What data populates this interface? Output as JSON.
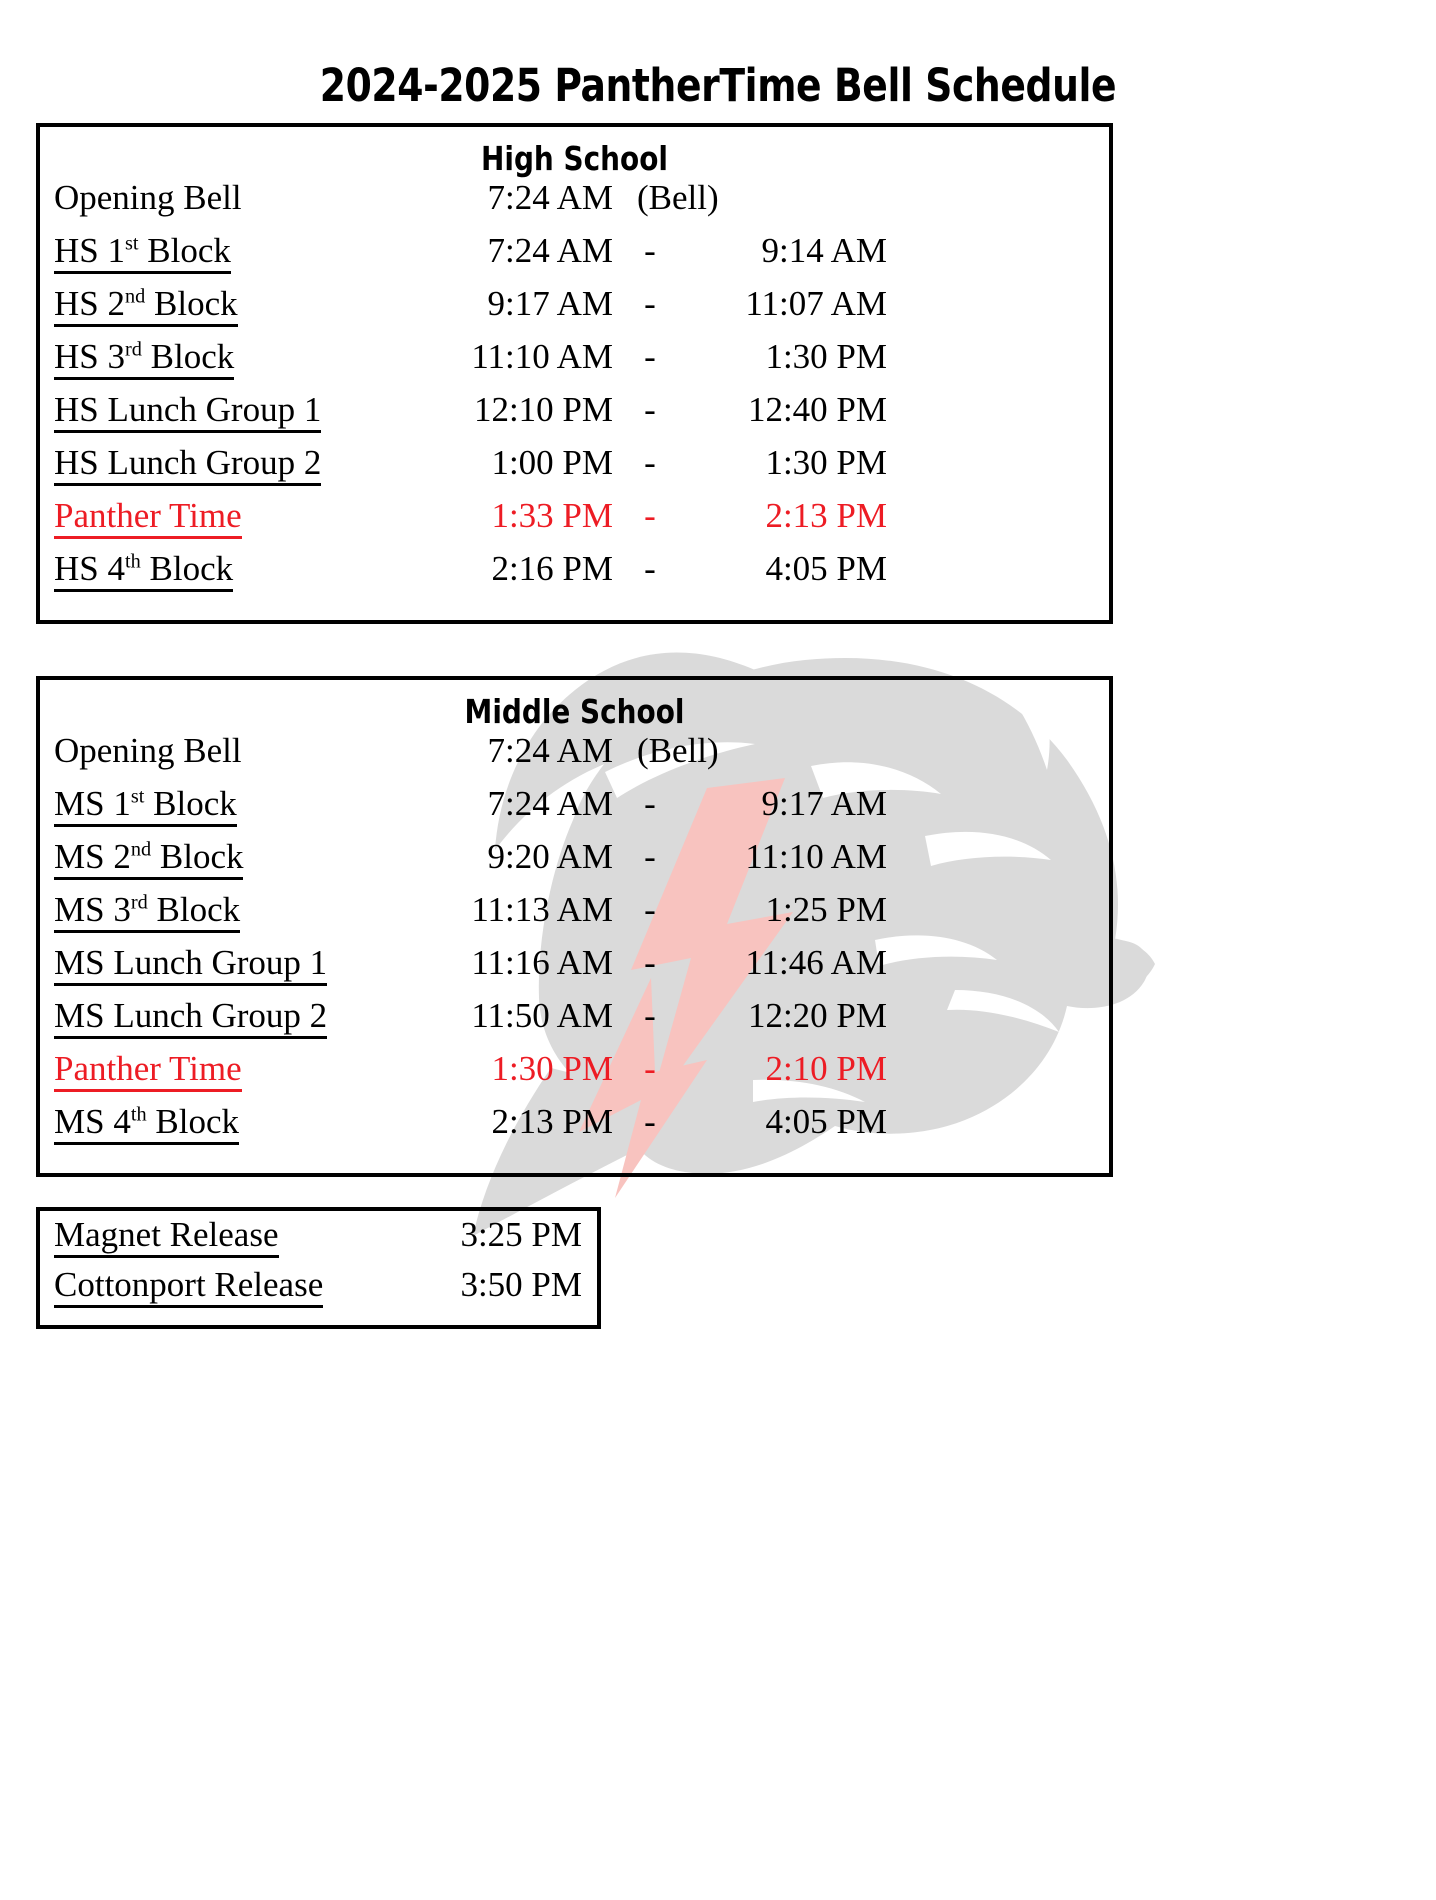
{
  "document": {
    "title": "2024-2025 PantherTime Bell Schedule"
  },
  "colors": {
    "accent_red": "#ED1C24",
    "text": "#000000",
    "border": "#000000",
    "watermark_gray": "#D4D4D4",
    "watermark_pink": "#F7B9B4"
  },
  "high_school": {
    "heading": "High School",
    "rows": [
      {
        "label": "Opening Bell",
        "ordinal": "",
        "underline": false,
        "start": "7:24 AM",
        "dash": "",
        "end": "",
        "note": "(Bell)",
        "red": false
      },
      {
        "label_pre": "HS 1",
        "ordinal": "st",
        "label_post": " Block ",
        "underline": true,
        "start": "7:24 AM",
        "dash": "-",
        "end": "9:14 AM",
        "note": "",
        "red": false
      },
      {
        "label_pre": "HS 2",
        "ordinal": "nd",
        "label_post": " Block ",
        "underline": true,
        "start": "9:17 AM",
        "dash": "-",
        "end": "11:07 AM",
        "note": "",
        "red": false
      },
      {
        "label_pre": "HS 3",
        "ordinal": "rd",
        "label_post": " Block ",
        "underline": true,
        "start": "11:10 AM",
        "dash": "-",
        "end": "1:30 PM",
        "note": "",
        "red": false
      },
      {
        "label": "HS Lunch Group 1",
        "ordinal": "",
        "underline": true,
        "start": "12:10 PM",
        "dash": "-",
        "end": "12:40 PM",
        "note": "",
        "red": false
      },
      {
        "label": "HS Lunch Group 2",
        "ordinal": "",
        "underline": true,
        "start": "1:00 PM",
        "dash": "-",
        "end": "1:30 PM",
        "note": "",
        "red": false
      },
      {
        "label": "Panther Time",
        "ordinal": "",
        "underline": true,
        "start": "1:33 PM",
        "dash": "-",
        "end": "2:13 PM",
        "note": "",
        "red": true
      },
      {
        "label_pre": "HS 4",
        "ordinal": "th",
        "label_post": " Block ",
        "underline": true,
        "start": "2:16 PM",
        "dash": "-",
        "end": "4:05 PM",
        "note": "",
        "red": false
      }
    ]
  },
  "middle_school": {
    "heading": "Middle School",
    "rows": [
      {
        "label": "Opening Bell",
        "ordinal": "",
        "underline": false,
        "start": "7:24 AM",
        "dash": "",
        "end": "",
        "note": "(Bell)",
        "red": false
      },
      {
        "label_pre": "MS 1",
        "ordinal": "st",
        "label_post": " Block ",
        "underline": true,
        "start": "7:24 AM",
        "dash": "-",
        "end": "9:17 AM",
        "note": "",
        "red": false
      },
      {
        "label_pre": "MS 2",
        "ordinal": "nd",
        "label_post": " Block ",
        "underline": true,
        "start": "9:20 AM",
        "dash": "-",
        "end": "11:10 AM",
        "note": "",
        "red": false
      },
      {
        "label_pre": "MS 3",
        "ordinal": "rd",
        "label_post": " Block ",
        "underline": true,
        "start": "11:13 AM",
        "dash": "-",
        "end": "1:25 PM",
        "note": "",
        "red": false
      },
      {
        "label": "MS Lunch Group 1",
        "ordinal": "",
        "underline": true,
        "start": "11:16 AM",
        "dash": "-",
        "end": "11:46 AM",
        "note": "",
        "red": false
      },
      {
        "label": "MS Lunch Group 2",
        "ordinal": "",
        "underline": true,
        "start": "11:50 AM",
        "dash": "-",
        "end": "12:20 PM",
        "note": "",
        "red": false
      },
      {
        "label": "Panther Time",
        "ordinal": "",
        "underline": true,
        "start": "1:30 PM",
        "dash": "-",
        "end": "2:10 PM",
        "note": "",
        "red": true
      },
      {
        "label_pre": "MS 4",
        "ordinal": "th",
        "label_post": " Block ",
        "underline": true,
        "start": "2:13 PM",
        "dash": "-",
        "end": "4:05 PM",
        "note": "",
        "red": false
      }
    ]
  },
  "release": {
    "rows": [
      {
        "label": "Magnet Release",
        "underline": true,
        "time": "3:25 PM"
      },
      {
        "label": "Cottonport Release",
        "underline": true,
        "time": "3:50 PM"
      }
    ]
  }
}
